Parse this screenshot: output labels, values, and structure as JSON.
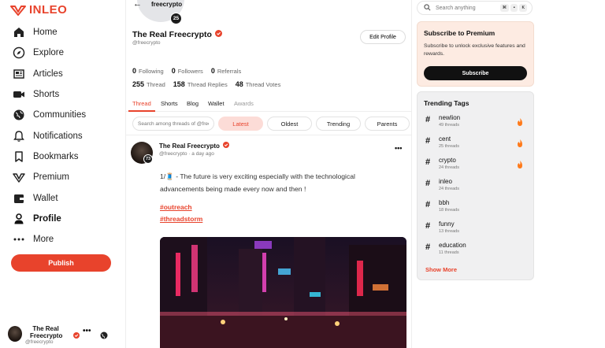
{
  "app": {
    "logo_text": "INLEO"
  },
  "sidebar": {
    "items": [
      {
        "label": "Home",
        "icon": "home-icon"
      },
      {
        "label": "Explore",
        "icon": "compass-icon"
      },
      {
        "label": "Articles",
        "icon": "newspaper-icon"
      },
      {
        "label": "Shorts",
        "icon": "video-camera-icon"
      },
      {
        "label": "Communities",
        "icon": "globe-icon"
      },
      {
        "label": "Notifications",
        "icon": "bell-icon"
      },
      {
        "label": "Bookmarks",
        "icon": "bookmark-icon"
      },
      {
        "label": "Premium",
        "icon": "premium-icon"
      },
      {
        "label": "Wallet",
        "icon": "wallet-icon"
      },
      {
        "label": "Profile",
        "icon": "user-icon"
      },
      {
        "label": "More",
        "icon": "more-dots-icon"
      }
    ],
    "publish_label": "Publish",
    "account": {
      "name": "The Real Freecrypto",
      "handle": "@freecrypto"
    }
  },
  "topbar": {
    "username": "freecrypto"
  },
  "profile": {
    "level": "25",
    "display_name": "The Real Freecrypto",
    "handle": "@freecrypto",
    "edit_label": "Edit Profile",
    "stats_row1": [
      {
        "value": "0",
        "label": "Following"
      },
      {
        "value": "0",
        "label": "Followers"
      },
      {
        "value": "0",
        "label": "Referrals"
      }
    ],
    "stats_row2": [
      {
        "value": "255",
        "label": "Thread"
      },
      {
        "value": "158",
        "label": "Thread Replies"
      },
      {
        "value": "48",
        "label": "Thread Votes"
      }
    ],
    "tabs": [
      "Thread",
      "Shorts",
      "Blog",
      "Wallet",
      "Awards"
    ],
    "active_tab": "Thread"
  },
  "filters": {
    "search_placeholder": "Search among threads of @freecrypto",
    "options": [
      "Latest",
      "Oldest",
      "Trending",
      "Parents"
    ],
    "active": "Latest"
  },
  "post": {
    "author": "The Real Freecrypto",
    "level": "73",
    "handle": "@freecrypto",
    "time": "a day ago",
    "meta": "@freecrypto · a day ago",
    "more": "•••",
    "text": "1/🧵 - The future is very exciting especially with the technological advancements being made every now and then !",
    "hashtags": [
      "#outreach",
      "#threadstorm"
    ]
  },
  "right": {
    "search_placeholder": "Search anything",
    "kbd": [
      "⌘",
      "•",
      "K"
    ],
    "premium": {
      "title": "Subscribe to Premium",
      "description": "Subscribe to unlock exclusive features and rewards.",
      "button": "Subscribe"
    },
    "trending": {
      "title": "Trending Tags",
      "tags": [
        {
          "name": "newlion",
          "count": "49 threads",
          "hot": true
        },
        {
          "name": "cent",
          "count": "25 threads",
          "hot": true
        },
        {
          "name": "crypto",
          "count": "24 threads",
          "hot": true
        },
        {
          "name": "inleo",
          "count": "24 threads",
          "hot": false
        },
        {
          "name": "bbh",
          "count": "18 threads",
          "hot": false
        },
        {
          "name": "funny",
          "count": "13 threads",
          "hot": false
        },
        {
          "name": "education",
          "count": "11 threads",
          "hot": false
        }
      ],
      "show_more": "Show More"
    }
  },
  "colors": {
    "accent": "#e8432c",
    "premium_bg": "#fdebe2",
    "tag_panel_bg": "#f0f0f1"
  }
}
